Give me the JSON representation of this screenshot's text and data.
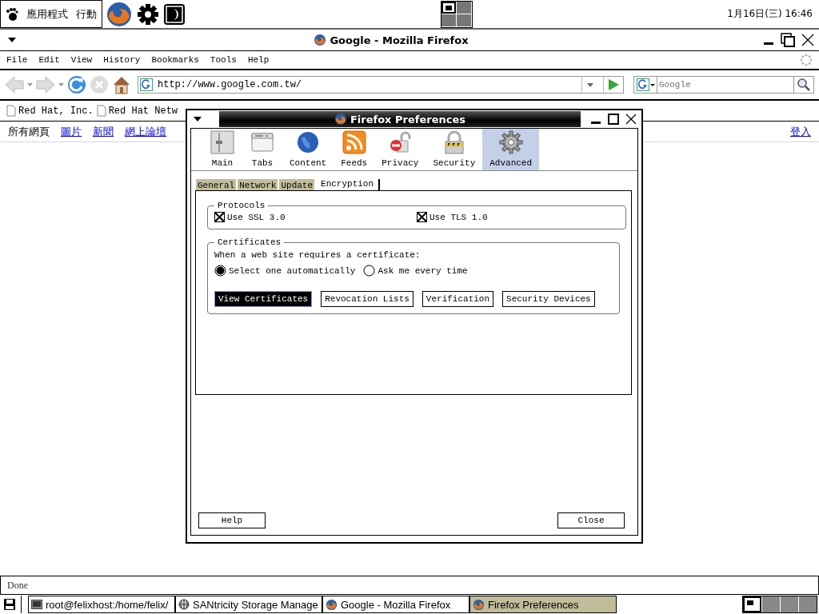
{
  "top_panel": {
    "menus": [
      "應用程式",
      "行動"
    ],
    "workspaces": [
      {
        "selected": true
      },
      {
        "selected": false
      },
      {
        "selected": false
      },
      {
        "selected": false
      }
    ],
    "clock": "1月16日(三) 16:46"
  },
  "browser": {
    "title": "Google - Mozilla Firefox",
    "menu": [
      "File",
      "Edit",
      "View",
      "History",
      "Bookmarks",
      "Tools",
      "Help"
    ],
    "address": "http://www.google.com.tw/",
    "search_placeholder": "Google",
    "bookmarks": [
      "Red Hat, Inc.",
      "Red Hat Netw"
    ],
    "google_links": [
      {
        "label": "所有網頁",
        "kind": "text"
      },
      {
        "label": "圖片",
        "kind": "link"
      },
      {
        "label": "新聞",
        "kind": "link"
      },
      {
        "label": "網上論壇",
        "kind": "link"
      }
    ],
    "sign_in": "登入",
    "status": "Done"
  },
  "dialog": {
    "title": "Firefox Preferences",
    "panes": [
      {
        "label": "Main",
        "selected": false
      },
      {
        "label": "Tabs",
        "selected": false
      },
      {
        "label": "Content",
        "selected": false
      },
      {
        "label": "Feeds",
        "selected": false
      },
      {
        "label": "Privacy",
        "selected": false
      },
      {
        "label": "Security",
        "selected": false
      },
      {
        "label": "Advanced",
        "selected": true
      }
    ],
    "tabs": [
      {
        "label": "General",
        "selected": false
      },
      {
        "label": "Network",
        "selected": false
      },
      {
        "label": "Update",
        "selected": false
      },
      {
        "label": "Encryption",
        "selected": true
      }
    ],
    "protocols": {
      "title": "Protocols",
      "options": [
        {
          "label": "Use SSL 3.0",
          "checked": true
        },
        {
          "label": "Use TLS 1.0",
          "checked": true
        }
      ]
    },
    "certificates": {
      "title": "Certificates",
      "prompt": "When a web site requires a certificate:",
      "choices": [
        {
          "label": "Select one automatically",
          "selected": true
        },
        {
          "label": "Ask me every time",
          "selected": false
        }
      ],
      "buttons": [
        {
          "label": "View Certificates",
          "focused": true
        },
        {
          "label": "Revocation Lists",
          "focused": false
        },
        {
          "label": "Verification",
          "focused": false
        },
        {
          "label": "Security Devices",
          "focused": false
        }
      ]
    },
    "buttons": [
      "Help",
      "Close"
    ]
  },
  "taskbar": {
    "items": [
      {
        "label": "root@felixhost:/home/felix/",
        "selected": false
      },
      {
        "label": "SANtricity Storage Manage",
        "selected": false
      },
      {
        "label": "Google - Mozilla Firefox",
        "selected": false
      },
      {
        "label": "Firefox Preferences",
        "selected": true
      }
    ],
    "workspaces": [
      {
        "selected": true
      },
      {
        "selected": false
      },
      {
        "selected": false
      },
      {
        "selected": false
      }
    ]
  }
}
